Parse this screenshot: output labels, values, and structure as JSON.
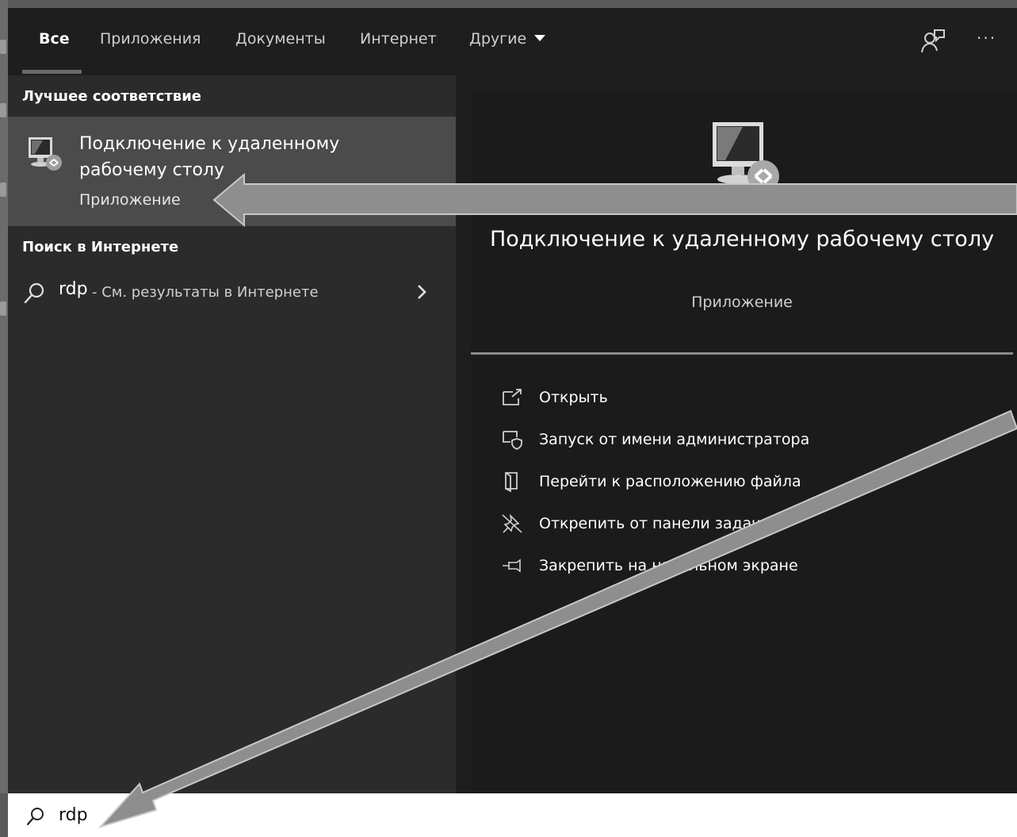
{
  "tabs": [
    {
      "label": "Все",
      "active": true
    },
    {
      "label": "Приложения"
    },
    {
      "label": "Документы"
    },
    {
      "label": "Интернет"
    },
    {
      "label": "Другие"
    }
  ],
  "header": {
    "feedback_icon": "feedback-icon",
    "more_icon": "more-icon",
    "more_label": "···"
  },
  "best_match": {
    "heading": "Лучшее соответствие",
    "title": "Подключение к удаленному рабочему столу",
    "subtitle": "Приложение",
    "icon": "remote-desktop-icon"
  },
  "web_search": {
    "heading": "Поиск в Интернете",
    "query": "rdp",
    "suffix": "- См. результаты в Интернете",
    "icon": "search-icon"
  },
  "details": {
    "title": "Подключение к удаленному рабочему столу",
    "subtitle": "Приложение",
    "actions": [
      {
        "label": "Открыть",
        "icon": "open-icon"
      },
      {
        "label": "Запуск от имени администратора",
        "icon": "run-as-admin-icon"
      },
      {
        "label": "Перейти к расположению файла",
        "icon": "file-location-icon"
      },
      {
        "label": "Открепить от панели задач",
        "icon": "unpin-taskbar-icon"
      },
      {
        "label": "Закрепить на начальном экране",
        "icon": "pin-start-icon"
      }
    ]
  },
  "search_box": {
    "value": "rdp"
  },
  "colors": {
    "panel_dark": "#1e1e1e",
    "panel_left": "#2b2b2b",
    "highlight": "#4b4b4b",
    "annotation_arrow": "#8e8e8e"
  }
}
